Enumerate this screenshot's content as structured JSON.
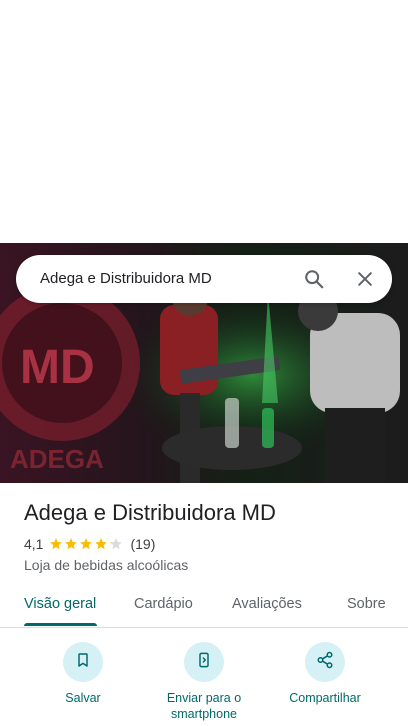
{
  "search": {
    "query": "Adega e Distribuidora MD"
  },
  "place": {
    "name": "Adega e Distribuidora MD",
    "rating": "4,1",
    "stars": 4.1,
    "review_count": "(19)",
    "category": "Loja de bebidas alcoólicas"
  },
  "tabs": [
    {
      "label": "Visão geral",
      "active": true
    },
    {
      "label": "Cardápio",
      "active": false
    },
    {
      "label": "Avaliações",
      "active": false
    },
    {
      "label": "Sobre",
      "active": false
    }
  ],
  "actions": [
    {
      "label": "Salvar",
      "icon": "bookmark-icon"
    },
    {
      "label": "Enviar para o smartphone",
      "icon": "send-to-phone-icon"
    },
    {
      "label": "Compartilhar",
      "icon": "share-icon"
    }
  ],
  "colors": {
    "accent": "#01696b",
    "action_bg": "#d5f1f6",
    "star": "#fbbc04",
    "star_empty": "#dadce0"
  }
}
